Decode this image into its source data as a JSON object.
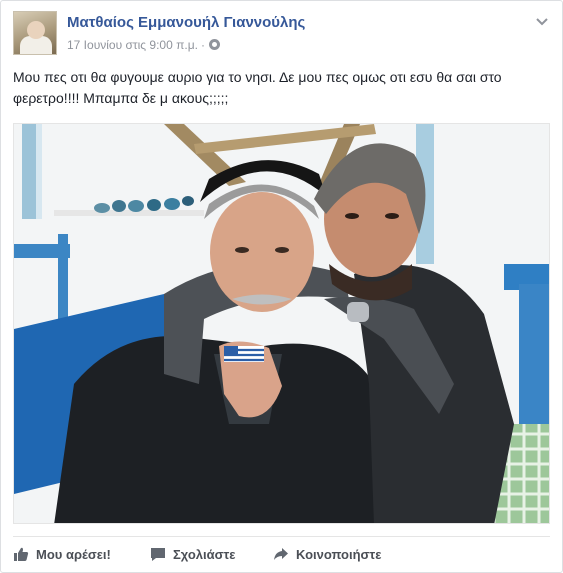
{
  "post": {
    "author": "Ματθαίος Εμμανουήλ Γιαννούλης",
    "timestamp": "17 Ιουνίου στις 9:00 π.μ.",
    "dot": "·",
    "text": "Μου πες οτι θα φυγουμε αυριο για το νησι. Δε μου πες ομως οτι εσυ θα σαι στο φερετρο!!!! Μπαμπα δε μ ακους;;;;;"
  },
  "actions": {
    "like": "Μου αρέσει!",
    "comment": "Σχολιάστε",
    "share": "Κοινοποιήστε"
  },
  "icons": {
    "header": [
      "chevron-down-icon",
      "globe-icon"
    ],
    "actions": [
      "thumbs-up-icon",
      "comment-icon",
      "share-icon"
    ]
  },
  "colors": {
    "author_link": "#365899",
    "meta_text": "#90949c",
    "action_text": "#4b4f56",
    "body_text": "#1d2129"
  }
}
